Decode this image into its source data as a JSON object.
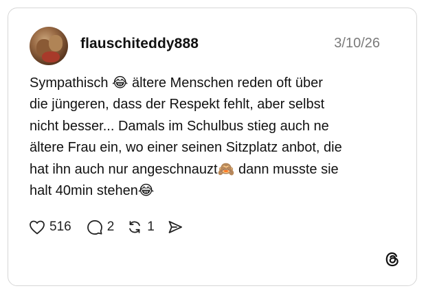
{
  "post": {
    "username": "flauschiteddy888",
    "date": "3/10/26",
    "text": "Sympathisch 😂 ältere Menschen reden oft über\ndie jüngeren, dass der Respekt fehlt, aber selbst\nnicht besser... Damals im Schulbus stieg auch ne\nältere Frau ein, wo einer seinen Sitzplatz anbot, die\nhat ihn auch nur angeschnauzt🙈 dann musste sie\nhalt 40min stehen😂"
  },
  "actions": {
    "likes": "516",
    "replies": "2",
    "reposts": "1"
  },
  "icons": {
    "like": "heart-icon",
    "reply": "comment-icon",
    "repost": "repost-icon",
    "share": "share-icon",
    "brand": "threads-logo-icon"
  }
}
